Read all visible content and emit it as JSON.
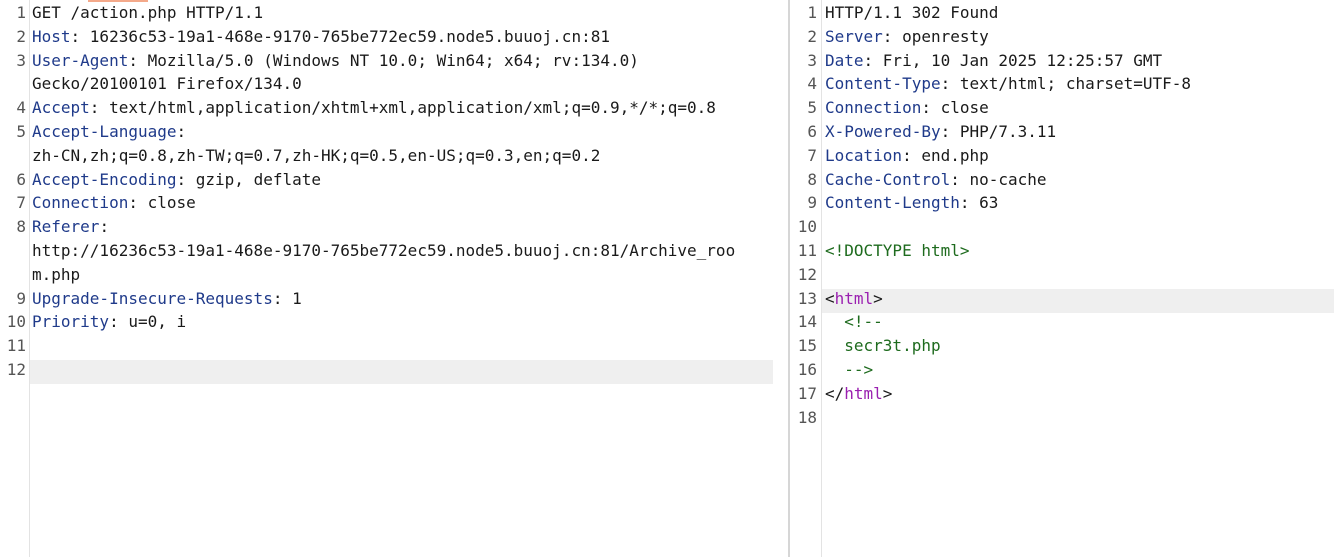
{
  "request": {
    "lines": [
      {
        "n": "1",
        "key": "",
        "value": "GET /action.php HTTP/1.1"
      },
      {
        "n": "2",
        "key": "Host",
        "value": ": 16236c53-19a1-468e-9170-765be772ec59.node5.buuoj.cn:81"
      },
      {
        "n": "3",
        "key": "User-Agent",
        "value": ": Mozilla/5.0 (Windows NT 10.0; Win64; x64; rv:134.0)"
      },
      {
        "n": "",
        "key": "",
        "value": "Gecko/20100101 Firefox/134.0"
      },
      {
        "n": "4",
        "key": "Accept",
        "value": ": text/html,application/xhtml+xml,application/xml;q=0.9,*/*;q=0.8"
      },
      {
        "n": "5",
        "key": "Accept-Language",
        "value": ":"
      },
      {
        "n": "",
        "key": "",
        "value": "zh-CN,zh;q=0.8,zh-TW;q=0.7,zh-HK;q=0.5,en-US;q=0.3,en;q=0.2"
      },
      {
        "n": "6",
        "key": "Accept-Encoding",
        "value": ": gzip, deflate"
      },
      {
        "n": "7",
        "key": "Connection",
        "value": ": close"
      },
      {
        "n": "8",
        "key": "Referer",
        "value": ":"
      },
      {
        "n": "",
        "key": "",
        "value": "http://16236c53-19a1-468e-9170-765be772ec59.node5.buuoj.cn:81/Archive_roo"
      },
      {
        "n": "",
        "key": "",
        "value": "m.php"
      },
      {
        "n": "9",
        "key": "Upgrade-Insecure-Requests",
        "value": ": 1"
      },
      {
        "n": "10",
        "key": "Priority",
        "value": ": u=0, i"
      },
      {
        "n": "11",
        "key": "",
        "value": ""
      },
      {
        "n": "12",
        "key": "",
        "value": ""
      }
    ]
  },
  "response": {
    "lines": [
      {
        "n": "1",
        "key": "",
        "value": "HTTP/1.1 302 Found"
      },
      {
        "n": "2",
        "key": "Server",
        "value": ": openresty"
      },
      {
        "n": "3",
        "key": "Date",
        "value": ": Fri, 10 Jan 2025 12:25:57 GMT"
      },
      {
        "n": "4",
        "key": "Content-Type",
        "value": ": text/html; charset=UTF-8"
      },
      {
        "n": "5",
        "key": "Connection",
        "value": ": close"
      },
      {
        "n": "6",
        "key": "X-Powered-By",
        "value": ": PHP/7.3.11"
      },
      {
        "n": "7",
        "key": "Location",
        "value": ": end.php"
      },
      {
        "n": "8",
        "key": "Cache-Control",
        "value": ": no-cache"
      },
      {
        "n": "9",
        "key": "Content-Length",
        "value": ": 63"
      },
      {
        "n": "10",
        "key": "",
        "value": ""
      },
      {
        "n": "11",
        "key": "",
        "value": "<!DOCTYPE html>"
      },
      {
        "n": "12",
        "key": "",
        "value": ""
      },
      {
        "n": "13",
        "key": "",
        "value": "<html>"
      },
      {
        "n": "14",
        "key": "",
        "value": "  <!--"
      },
      {
        "n": "15",
        "key": "",
        "value": "  secr3t.php"
      },
      {
        "n": "16",
        "key": "",
        "value": "  -->"
      },
      {
        "n": "17",
        "key": "",
        "value": "</html>"
      },
      {
        "n": "18",
        "key": "",
        "value": ""
      }
    ]
  }
}
